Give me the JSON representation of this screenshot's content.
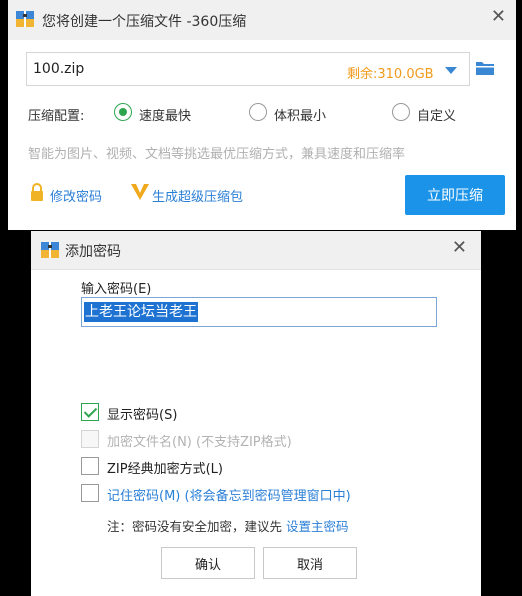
{
  "main_dialog": {
    "title": "您将创建一个压缩文件 -360压缩",
    "filename": "100.zip",
    "remaining": "剩余:310.0GB",
    "config_label": "压缩配置:",
    "options": [
      "速度最快",
      "体积最小",
      "自定义"
    ],
    "selected_option": "速度最快",
    "hint": "智能为图片、视频、文档等挑选最优压缩方式，兼具速度和压缩率",
    "change_password": "修改密码",
    "super_package": "生成超级压缩包",
    "compress_button": "立即压缩"
  },
  "password_dialog": {
    "title": "添加密码",
    "password_label": "输入密码(E)",
    "password_value": "上老王论坛当老王",
    "show_password": "显示密码(S)",
    "encrypt_filename": "加密文件名(N) (不支持ZIP格式)",
    "zip_classic": "ZIP经典加密方式(L)",
    "remember_password": "记住密码(M) (将会备忘到密码管理窗口中)",
    "note_prefix": "注：密码没有安全加密，建议先",
    "note_link": "设置主密码",
    "ok_button": "确认",
    "cancel_button": "取消"
  },
  "colors": {
    "accent_blue": "#1a93e8",
    "link_blue": "#2a7fd6",
    "remaining_orange": "#f09a1c",
    "check_green": "#2fa44f",
    "selection_blue": "#1e73d2"
  }
}
